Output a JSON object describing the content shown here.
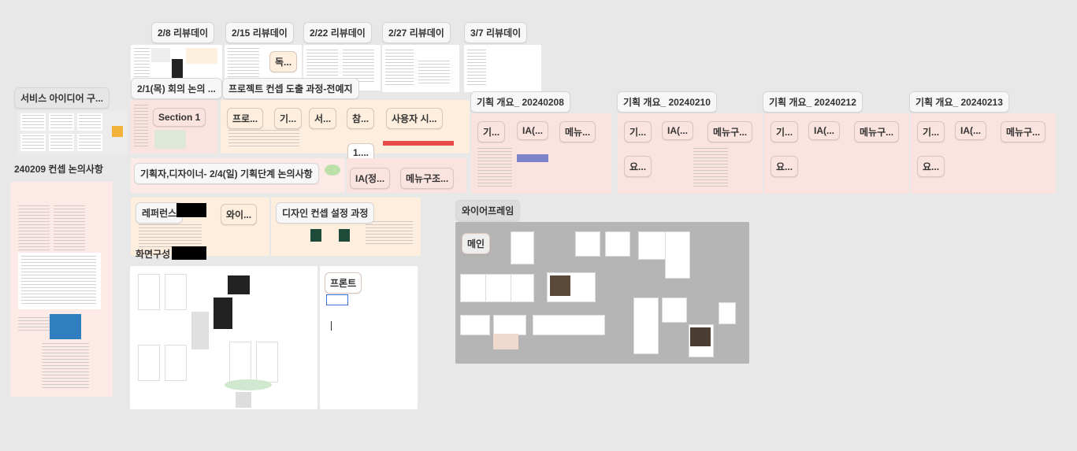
{
  "review_labels": [
    "2/8 리뷰데이",
    "2/15 리뷰데이",
    "2/22 리뷰데이",
    "2/27 리뷰데이",
    "3/7 리뷰데이"
  ],
  "left_col": {
    "idea_title": "서비스 아이디어 구...",
    "concept_title": "240209 컨셉 논의사항"
  },
  "row1": {
    "meeting_title": "2/1(목) 회의 논의 ...",
    "project_title": "프로젝트 컨셉 도출 과정-전예지",
    "section_label": "Section 1",
    "tags": [
      "프로...",
      "기...",
      "서...",
      "참...",
      "사용자 시..."
    ],
    "doc_label": "독...",
    "small_1": "1...."
  },
  "row2": {
    "planner_title": "기획자,디자이너- 2/4(일) 기획단계 논의사항",
    "ia_label": "IA(정...",
    "menu_label": "메뉴구조..."
  },
  "row3": {
    "reference_title": "레퍼런스",
    "wire_small": "와이...",
    "design_title": "디자인 컨셉 설정 과정"
  },
  "screen_title": "화면구성",
  "front_label": "프론트",
  "plans": [
    {
      "title": "기획 개요_ 20240208",
      "tags": [
        "기...",
        "IA(...",
        "메뉴..."
      ]
    },
    {
      "title": "기획 개요_ 20240210",
      "tags": [
        "기...",
        "IA(...",
        "메뉴구...",
        "요..."
      ]
    },
    {
      "title": "기획 개요_ 20240212",
      "tags": [
        "기...",
        "IA(...",
        "메뉴구...",
        "요..."
      ]
    },
    {
      "title": "기획 개요_ 20240213",
      "tags": [
        "기...",
        "IA(...",
        "메뉴구...",
        "요..."
      ]
    }
  ],
  "wireframe": {
    "title": "와이어프레임",
    "main_label": "메인"
  },
  "colors": {
    "canvas": "#e8e8e8",
    "section_pink": "#fbe3df",
    "section_peach": "#fdeedd",
    "wireframe_gray": "#b5b5b5"
  }
}
